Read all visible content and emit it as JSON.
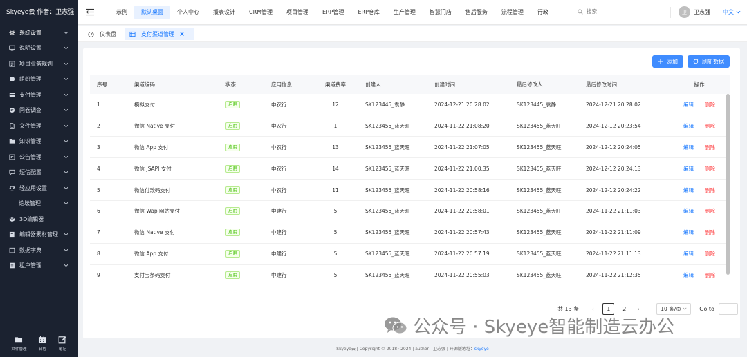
{
  "app": {
    "title": "Skyeye云 作者：卫志强"
  },
  "sidebar": {
    "items": [
      {
        "label": "系统设置",
        "icon": "gear-icon",
        "active": true
      },
      {
        "label": "说明设置",
        "icon": "monitor-icon"
      },
      {
        "label": "项目业务规划",
        "icon": "list-icon"
      },
      {
        "label": "组织管理",
        "icon": "org-icon"
      },
      {
        "label": "支付管理",
        "icon": "card-icon"
      },
      {
        "label": "问卷调查",
        "icon": "chat-icon"
      },
      {
        "label": "文件管理",
        "icon": "file-icon"
      },
      {
        "label": "知识管理",
        "icon": "folder-icon"
      },
      {
        "label": "公告管理",
        "icon": "notice-icon"
      },
      {
        "label": "短信配置",
        "icon": "message-icon"
      },
      {
        "label": "轻应用设置",
        "icon": "scale-icon"
      },
      {
        "label": "论坛管理",
        "icon": "",
        "sub": true
      },
      {
        "label": "3D编辑器",
        "icon": "cube-icon",
        "nochev": true
      },
      {
        "label": "编辑器素材管理",
        "icon": "edit-icon"
      },
      {
        "label": "数据字典",
        "icon": "book-icon"
      },
      {
        "label": "租户管理",
        "icon": "doc-icon"
      }
    ],
    "footer": [
      {
        "label": "文件管理",
        "icon": "folder-icon"
      },
      {
        "label": "日程",
        "icon": "calendar-icon"
      },
      {
        "label": "笔记",
        "icon": "note-icon"
      }
    ]
  },
  "topnav": {
    "items": [
      "示例",
      "默认桌面",
      "个人中心",
      "报表设计",
      "CRM管理",
      "项目管理",
      "ERP管理",
      "ERP仓库",
      "生产管理",
      "智慧门店",
      "售后服务",
      "流程管理",
      "行政"
    ],
    "active_index": 1,
    "search_placeholder": "搜索",
    "user": {
      "avatar_text": "卫",
      "name": "卫志强"
    },
    "language": "中文"
  },
  "tabs": [
    {
      "label": "仪表盘",
      "icon": "dashboard-icon"
    },
    {
      "label": "支付渠道管理",
      "icon": "table-icon",
      "active": true
    }
  ],
  "toolbar": {
    "add_label": "添加",
    "refresh_label": "刷新数据"
  },
  "table": {
    "columns": [
      "序号",
      "渠道编码",
      "状态",
      "应用信息",
      "渠道费率",
      "创建人",
      "创建时间",
      "最后修改人",
      "最后修改时间",
      "操作"
    ],
    "status_text": "启用",
    "edit_label": "编辑",
    "delete_label": "删除",
    "rows": [
      {
        "no": "1",
        "name": "模拟支付",
        "app": "中农行",
        "rate": "12",
        "creator": "SK123445_袁静",
        "created": "2024-12-21 20:28:02",
        "modifier": "SK123445_袁静",
        "modified": "2024-12-21 20:28:02"
      },
      {
        "no": "2",
        "name": "微信 Native 支付",
        "app": "中农行",
        "rate": "1",
        "creator": "SK123455_蓝天旺",
        "created": "2024-11-22 21:08:20",
        "modifier": "SK123455_蓝天旺",
        "modified": "2024-12-12 20:23:54"
      },
      {
        "no": "3",
        "name": "微信 App 支付",
        "app": "中农行",
        "rate": "13",
        "creator": "SK123455_蓝天旺",
        "created": "2024-11-22 21:07:05",
        "modifier": "SK123455_蓝天旺",
        "modified": "2024-12-12 20:24:05"
      },
      {
        "no": "4",
        "name": "微信 JSAPI 支付",
        "app": "中农行",
        "rate": "14",
        "creator": "SK123455_蓝天旺",
        "created": "2024-11-22 21:00:35",
        "modifier": "SK123455_蓝天旺",
        "modified": "2024-12-12 20:24:13"
      },
      {
        "no": "5",
        "name": "微信付款码支付",
        "app": "中农行",
        "rate": "11",
        "creator": "SK123455_蓝天旺",
        "created": "2024-11-22 20:58:16",
        "modifier": "SK123455_蓝天旺",
        "modified": "2024-12-12 20:24:22"
      },
      {
        "no": "6",
        "name": "微信 Wap 网站支付",
        "app": "中建行",
        "rate": "5",
        "creator": "SK123455_蓝天旺",
        "created": "2024-11-22 20:58:01",
        "modifier": "SK123455_蓝天旺",
        "modified": "2024-11-22 21:11:03"
      },
      {
        "no": "7",
        "name": "微信 Native 支付",
        "app": "中建行",
        "rate": "5",
        "creator": "SK123455_蓝天旺",
        "created": "2024-11-22 20:57:43",
        "modifier": "SK123455_蓝天旺",
        "modified": "2024-11-22 21:11:09"
      },
      {
        "no": "8",
        "name": "微信 App 支付",
        "app": "中建行",
        "rate": "5",
        "creator": "SK123455_蓝天旺",
        "created": "2024-11-22 20:57:19",
        "modifier": "SK123455_蓝天旺",
        "modified": "2024-11-22 21:11:13"
      },
      {
        "no": "9",
        "name": "支付宝条码支付",
        "app": "中建行",
        "rate": "5",
        "creator": "SK123455_蓝天旺",
        "created": "2024-11-22 20:55:03",
        "modifier": "SK123455_蓝天旺",
        "modified": "2024-11-22 21:12:35"
      }
    ]
  },
  "pagination": {
    "total_text": "共 13 条",
    "pages": [
      "1",
      "2"
    ],
    "current": "1",
    "page_size": "10 条/页",
    "goto_label": "Go to"
  },
  "footer": {
    "text": "Skyeye云 | Copyright © 2018~2024 | author：卫志强 | 开源版地址：",
    "link": "skyeye"
  },
  "watermark": {
    "text": "公众号 · Skyeye智能制造云办公"
  },
  "colors": {
    "primary": "#1677ff",
    "button": "#3f8cff",
    "sidebar_bg": "#1b2230",
    "success": "#52c41a",
    "danger": "#ff4d4f"
  }
}
